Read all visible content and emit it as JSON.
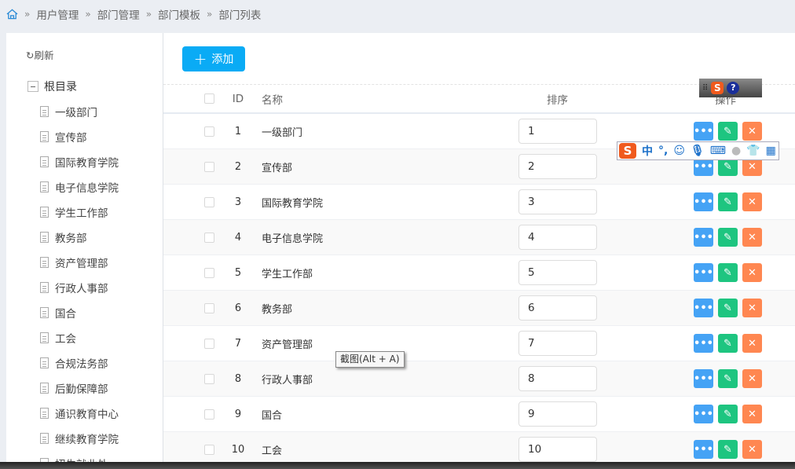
{
  "breadcrumb": [
    "用户管理",
    "部门管理",
    "部门模板",
    "部门列表"
  ],
  "sidebar": {
    "refresh": "刷新",
    "root": "根目录",
    "items": [
      "一级部门",
      "宣传部",
      "国际教育学院",
      "电子信息学院",
      "学生工作部",
      "教务部",
      "资产管理部",
      "行政人事部",
      "国合",
      "工会",
      "合规法务部",
      "后勤保障部",
      "通识教育中心",
      "继续教育学院",
      "招生就业处"
    ]
  },
  "toolbar": {
    "add": "添加"
  },
  "table": {
    "headers": {
      "id": "ID",
      "name": "名称",
      "sort": "排序",
      "ops": "操作"
    },
    "rows": [
      {
        "id": "1",
        "name": "一级部门",
        "sort": "1"
      },
      {
        "id": "2",
        "name": "宣传部",
        "sort": "2"
      },
      {
        "id": "3",
        "name": "国际教育学院",
        "sort": "3"
      },
      {
        "id": "4",
        "name": "电子信息学院",
        "sort": "4"
      },
      {
        "id": "5",
        "name": "学生工作部",
        "sort": "5"
      },
      {
        "id": "6",
        "name": "教务部",
        "sort": "6"
      },
      {
        "id": "7",
        "name": "资产管理部",
        "sort": "7"
      },
      {
        "id": "8",
        "name": "行政人事部",
        "sort": "8"
      },
      {
        "id": "9",
        "name": "国合",
        "sort": "9"
      },
      {
        "id": "10",
        "name": "工会",
        "sort": "10"
      }
    ]
  },
  "ime": {
    "lang": "中",
    "punct": "°,"
  },
  "tooltip": "截图(Alt + A)"
}
